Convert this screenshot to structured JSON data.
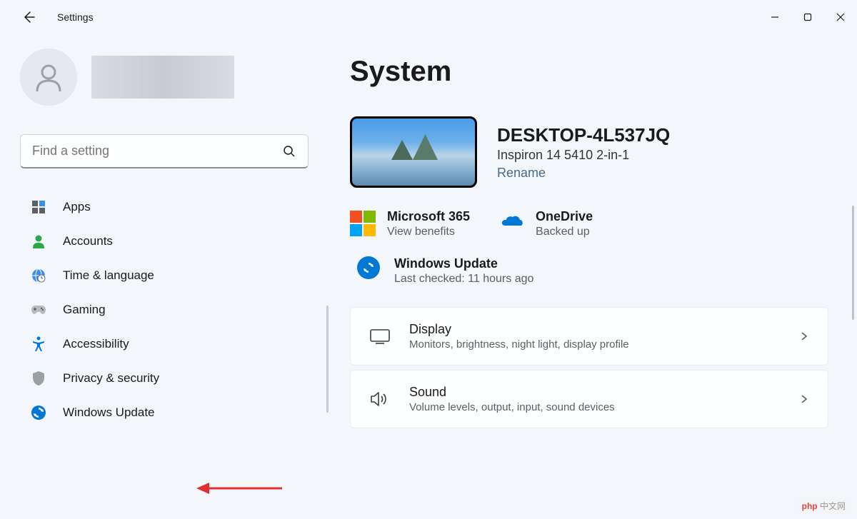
{
  "app": {
    "title": "Settings"
  },
  "search": {
    "placeholder": "Find a setting"
  },
  "sidebar": {
    "items": [
      {
        "label": "Apps"
      },
      {
        "label": "Accounts"
      },
      {
        "label": "Time & language"
      },
      {
        "label": "Gaming"
      },
      {
        "label": "Accessibility"
      },
      {
        "label": "Privacy & security"
      },
      {
        "label": "Windows Update"
      }
    ]
  },
  "main": {
    "title": "System",
    "device": {
      "name": "DESKTOP-4L537JQ",
      "model": "Inspiron 14 5410 2-in-1",
      "rename": "Rename"
    },
    "cards": {
      "m365": {
        "title": "Microsoft 365",
        "sub": "View benefits"
      },
      "onedrive": {
        "title": "OneDrive",
        "sub": "Backed up"
      },
      "update": {
        "title": "Windows Update",
        "sub": "Last checked: 11 hours ago"
      }
    },
    "settings": [
      {
        "title": "Display",
        "sub": "Monitors, brightness, night light, display profile"
      },
      {
        "title": "Sound",
        "sub": "Volume levels, output, input, sound devices"
      }
    ]
  },
  "watermark": "中文网"
}
